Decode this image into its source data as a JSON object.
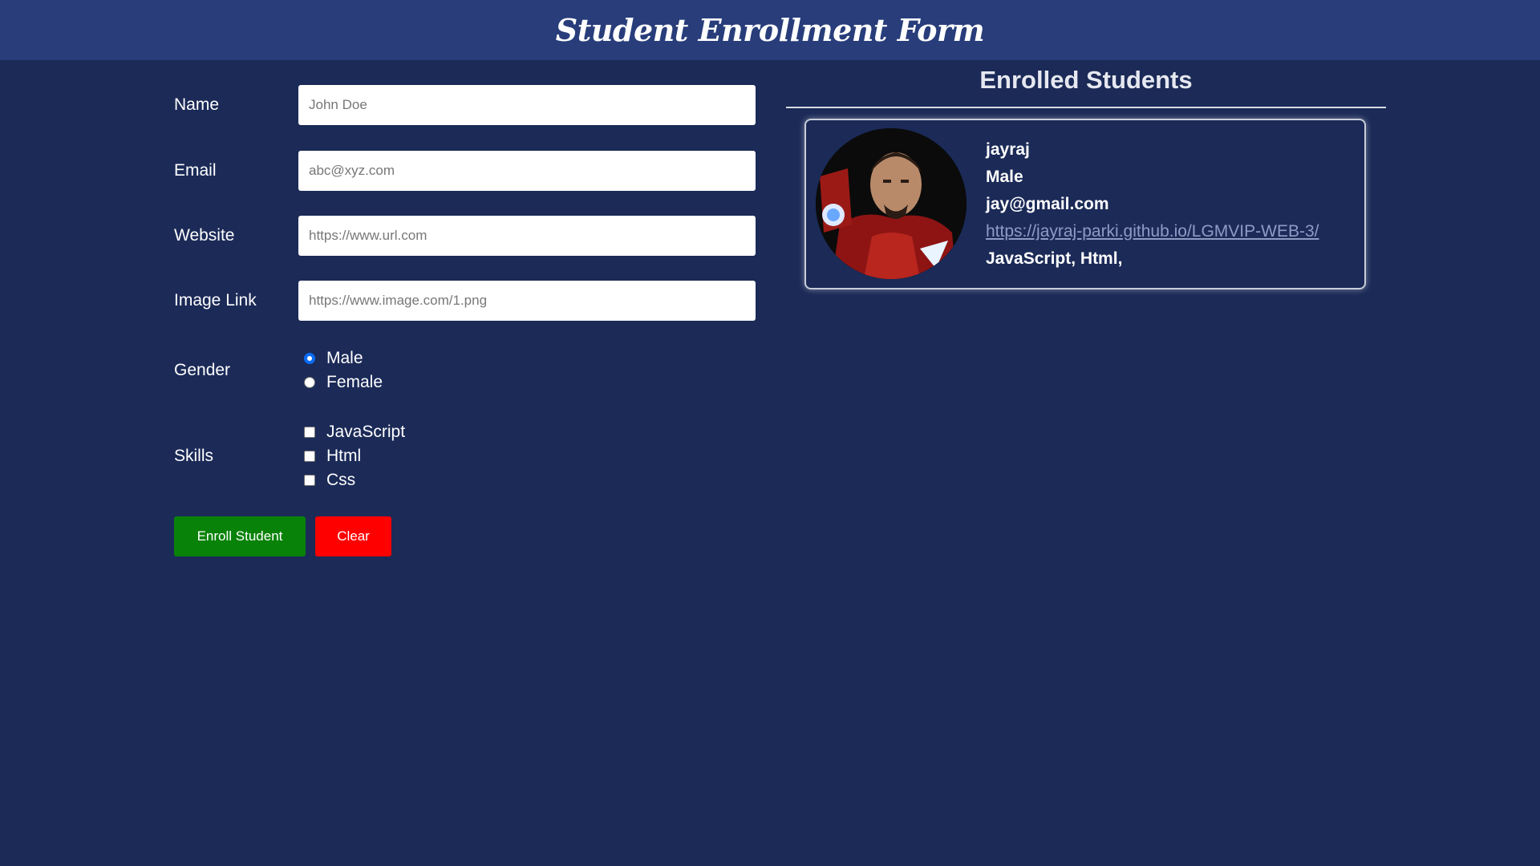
{
  "header": {
    "title": "Student Enrollment Form"
  },
  "form": {
    "name": {
      "label": "Name",
      "placeholder": "John Doe"
    },
    "email": {
      "label": "Email",
      "placeholder": "abc@xyz.com"
    },
    "website": {
      "label": "Website",
      "placeholder": "https://www.url.com"
    },
    "image": {
      "label": "Image Link",
      "placeholder": "https://www.image.com/1.png"
    },
    "gender": {
      "label": "Gender",
      "options": [
        "Male",
        "Female"
      ],
      "selected": "Male"
    },
    "skills": {
      "label": "Skills",
      "options": [
        "JavaScript",
        "Html",
        "Css"
      ]
    },
    "enroll_label": "Enroll Student",
    "clear_label": "Clear"
  },
  "enrolled": {
    "title": "Enrolled Students",
    "students": [
      {
        "name": "jayraj",
        "gender": "Male",
        "email": "jay@gmail.com",
        "website": "https://jayraj-parki.github.io/LGMVIP-WEB-3/",
        "skills": "JavaScript, Html,"
      }
    ]
  },
  "colors": {
    "background": "#1b2a57",
    "header": "#283d7a",
    "enroll_button": "#098209",
    "clear_button": "#ff0000"
  }
}
